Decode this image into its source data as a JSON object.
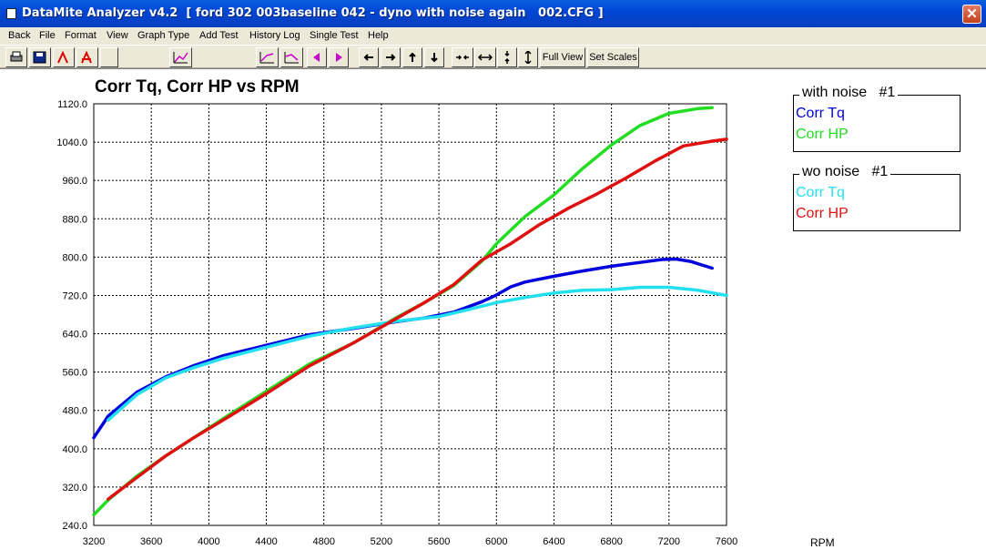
{
  "window": {
    "title": "DataMite Analyzer v4.2  [ ford 302 003baseline 042 - dyno with noise again   002.CFG ]"
  },
  "menu": [
    "Back",
    "File",
    "Format",
    "View",
    "Graph Type",
    "Add Test",
    "History Log",
    "Single Test",
    "Help"
  ],
  "toolbar": {
    "full_view_label": "Full View",
    "set_scales_label": "Set Scales"
  },
  "legend": [
    {
      "title": "with noise   #1",
      "items": [
        {
          "label": "Corr Tq",
          "color": "#0000dd"
        },
        {
          "label": "Corr HP",
          "color": "#22dd22"
        }
      ]
    },
    {
      "title": "wo noise   #1",
      "items": [
        {
          "label": "Corr Tq",
          "color": "#22e0f0"
        },
        {
          "label": "Corr HP",
          "color": "#e01010"
        }
      ]
    }
  ],
  "chart_data": {
    "type": "line",
    "title": "Corr Tq, Corr HP vs RPM",
    "xlabel": "RPM",
    "ylabel": "",
    "xlim": [
      3200,
      7600
    ],
    "ylim": [
      240,
      1120
    ],
    "xticks": [
      "3200",
      "3600",
      "4000",
      "4400",
      "4800",
      "5200",
      "5600",
      "6000",
      "6400",
      "6800",
      "7200",
      "7600"
    ],
    "yticks": [
      "240.0",
      "320.0",
      "400.0",
      "480.0",
      "560.0",
      "640.0",
      "720.0",
      "800.0",
      "880.0",
      "960.0",
      "1040.0",
      "1120.0"
    ],
    "grid": true,
    "series": [
      {
        "name": "Corr Tq (with noise #1)",
        "color": "#0000dd",
        "x": [
          3200,
          3300,
          3500,
          3700,
          3900,
          4100,
          4400,
          4700,
          5000,
          5300,
          5500,
          5700,
          5900,
          6000,
          6100,
          6200,
          6400,
          6600,
          6800,
          7000,
          7150,
          7250,
          7350,
          7500
        ],
        "y": [
          423,
          468,
          518,
          550,
          574,
          594,
          616,
          638,
          651,
          665,
          673,
          685,
          707,
          721,
          738,
          748,
          760,
          771,
          781,
          789,
          795,
          796,
          791,
          777
        ]
      },
      {
        "name": "Corr HP (with noise #1)",
        "color": "#22dd22",
        "x": [
          3200,
          3300,
          3500,
          3700,
          3900,
          4100,
          4400,
          4700,
          5000,
          5300,
          5500,
          5700,
          5900,
          6000,
          6200,
          6400,
          6600,
          6800,
          7000,
          7200,
          7400,
          7500
        ],
        "y": [
          262,
          293,
          343,
          385,
          424,
          463,
          520,
          577,
          620,
          673,
          705,
          740,
          792,
          828,
          885,
          930,
          985,
          1034,
          1075,
          1100,
          1110,
          1112
        ]
      },
      {
        "name": "Corr Tq (wo noise #1)",
        "color": "#22e0f0",
        "x": [
          3300,
          3500,
          3700,
          3900,
          4100,
          4400,
          4700,
          5000,
          5300,
          5600,
          5800,
          6000,
          6200,
          6400,
          6600,
          6800,
          7000,
          7200,
          7400,
          7600
        ],
        "y": [
          460,
          513,
          548,
          570,
          589,
          612,
          635,
          652,
          666,
          676,
          690,
          705,
          716,
          725,
          731,
          732,
          737,
          737,
          731,
          720
        ]
      },
      {
        "name": "Corr HP (wo noise #1)",
        "color": "#e01010",
        "x": [
          3300,
          3500,
          3700,
          3900,
          4100,
          4400,
          4700,
          5000,
          5300,
          5500,
          5700,
          5900,
          6100,
          6300,
          6500,
          6700,
          6900,
          7100,
          7300,
          7500,
          7600
        ],
        "y": [
          295,
          340,
          385,
          424,
          460,
          515,
          573,
          620,
          671,
          705,
          742,
          794,
          828,
          868,
          902,
          932,
          965,
          1000,
          1032,
          1042,
          1046
        ]
      }
    ]
  }
}
